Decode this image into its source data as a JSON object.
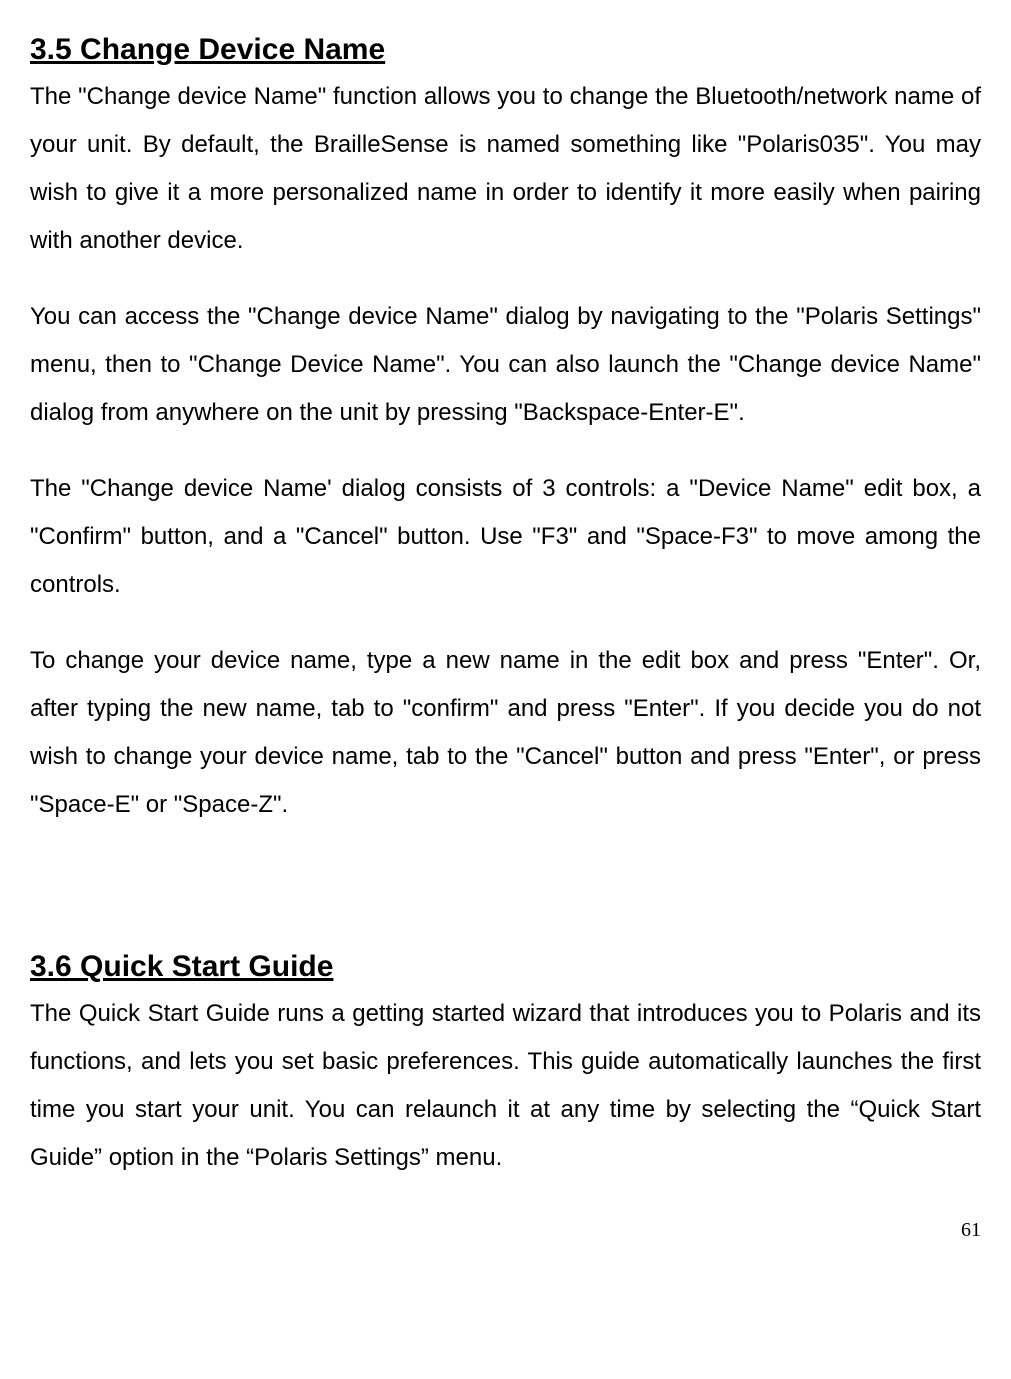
{
  "sections": {
    "changeDeviceName": {
      "heading": "3.5 Change Device Name",
      "paragraphs": {
        "p1": "The \"Change device Name\" function allows you to change the Bluetooth/network name of your unit. By default, the BrailleSense is named something like \"Polaris035\". You may wish to give it a more personalized name in order to identify it more easily when pairing with another device.",
        "p2": "You can access the \"Change device Name\" dialog by navigating to the \"Polaris Settings\" menu, then to \"Change Device Name\". You can also launch the \"Change device Name\" dialog from anywhere on the unit by pressing \"Backspace-Enter-E\".",
        "p3": "The \"Change device Name' dialog consists of 3 controls: a \"Device Name\" edit box, a \"Confirm\" button, and a \"Cancel\" button. Use \"F3\" and \"Space-F3\" to move among the controls.",
        "p4": "To change your device name, type a new name in the edit box and press \"Enter\". Or, after typing the new name, tab to \"confirm\" and press \"Enter\". If you decide you do not wish to change your device name, tab to the \"Cancel\" button and press \"Enter\", or press \"Space-E\" or \"Space-Z\"."
      }
    },
    "quickStartGuide": {
      "heading": "3.6 Quick Start Guide",
      "paragraphs": {
        "p1": "The Quick Start Guide runs a getting started wizard that introduces you to Polaris and its functions, and lets you set basic preferences. This guide automatically launches the first time you start your unit. You can relaunch it at any time by selecting the “Quick Start Guide” option in the “Polaris Settings” menu."
      }
    }
  },
  "pageNumber": "61"
}
